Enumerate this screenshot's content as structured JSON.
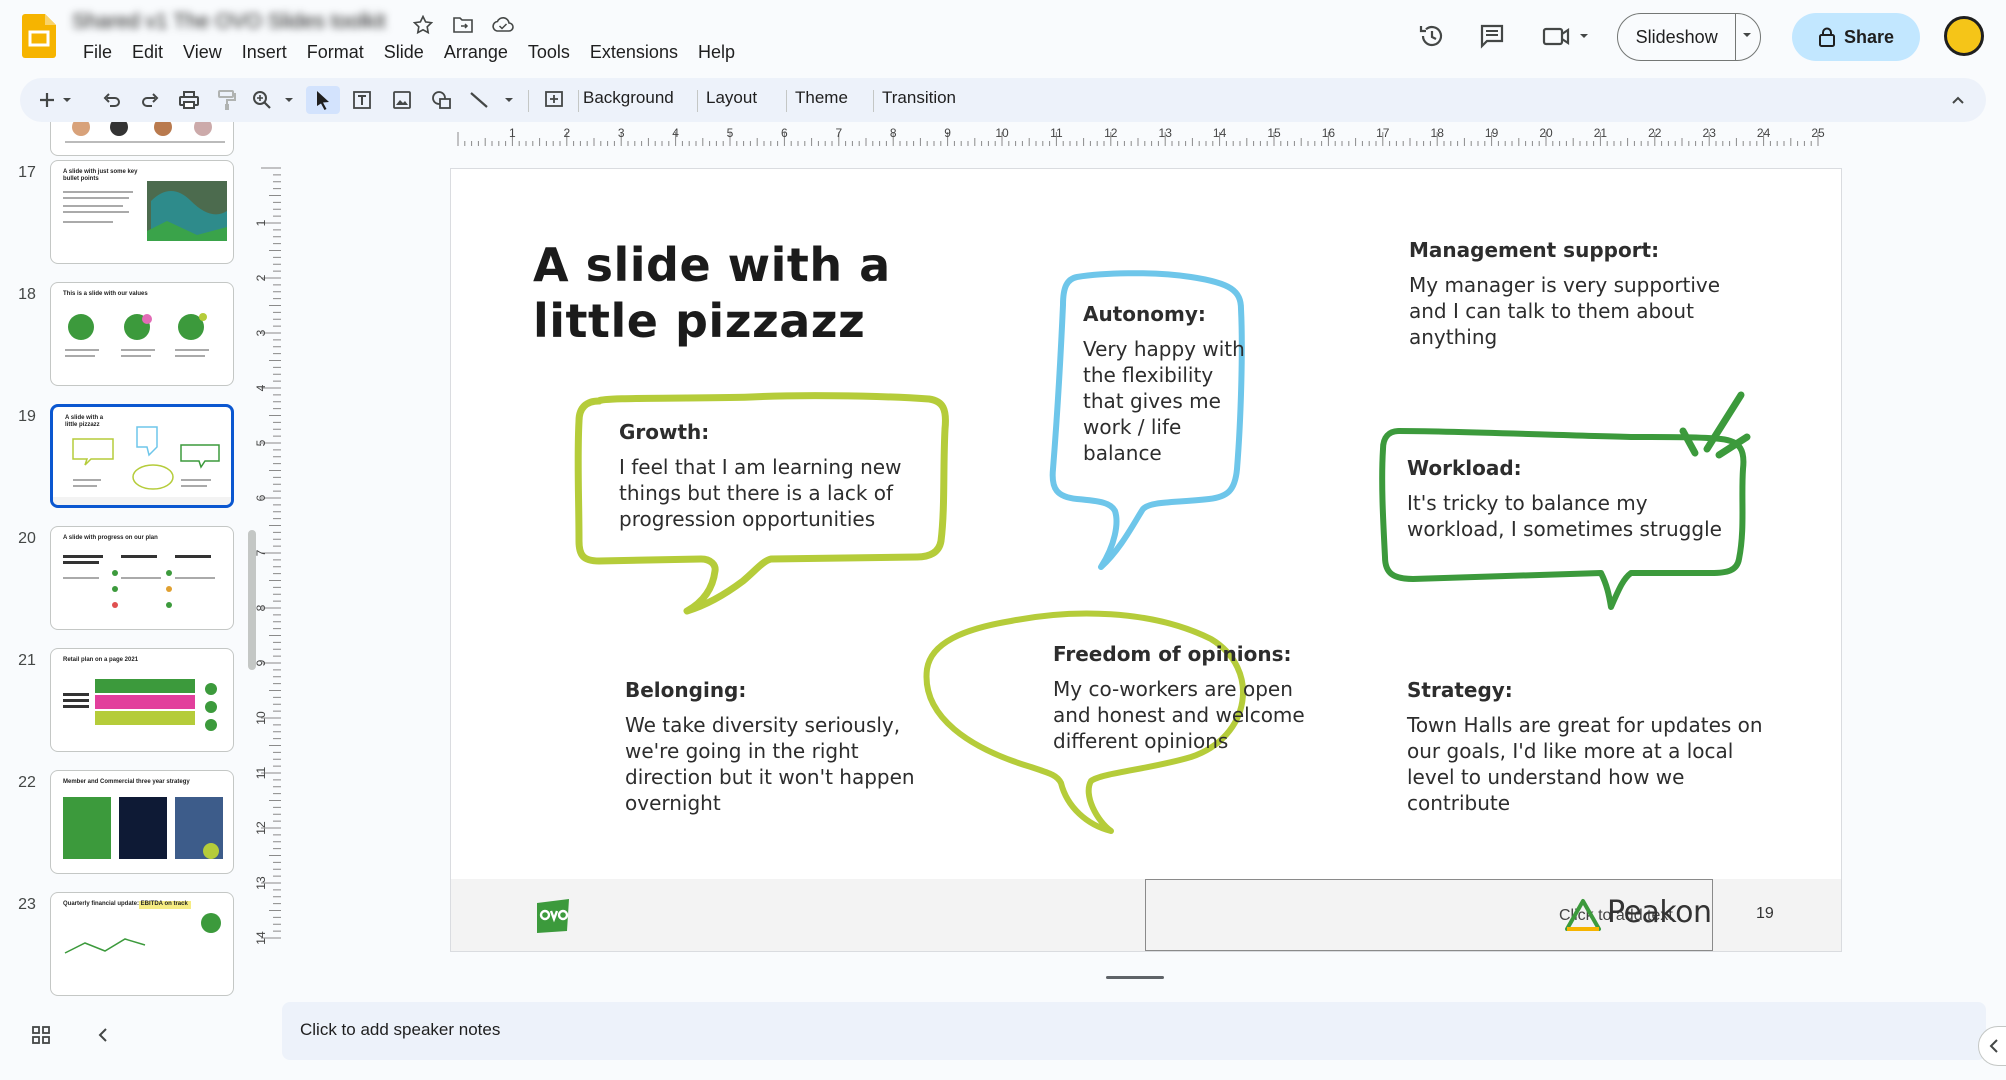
{
  "app": {
    "doc_title": "Shared v1 The OVO Slides toolkit",
    "menu": [
      "File",
      "Edit",
      "View",
      "Insert",
      "Format",
      "Slide",
      "Arrange",
      "Tools",
      "Extensions",
      "Help"
    ]
  },
  "header": {
    "slideshow_label": "Slideshow",
    "share_label": "Share"
  },
  "toolbar": {
    "background": "Background",
    "layout": "Layout",
    "theme": "Theme",
    "transition": "Transition"
  },
  "filmstrip": {
    "slides": [
      {
        "num": "17",
        "title": "A slide with just some key bullet points"
      },
      {
        "num": "18",
        "title": "This is a slide with our values"
      },
      {
        "num": "19",
        "title": "A slide with a little pizzazz"
      },
      {
        "num": "20",
        "title": "A slide with progress on our plan"
      },
      {
        "num": "21",
        "title": "Retail plan on a page 2021"
      },
      {
        "num": "22",
        "title": "Member and Commercial three year strategy"
      },
      {
        "num": "23",
        "title": "Quarterly financial update: EBITDA on track"
      }
    ]
  },
  "ruler": {
    "h": [
      "1",
      "2",
      "3",
      "4",
      "5",
      "6",
      "7",
      "8",
      "9",
      "10",
      "11",
      "12",
      "13",
      "14",
      "15",
      "16",
      "17",
      "18",
      "19",
      "20",
      "21",
      "22",
      "23",
      "24",
      "25"
    ],
    "v": [
      "1",
      "2",
      "3",
      "4",
      "5",
      "6",
      "7",
      "8",
      "9",
      "10",
      "11",
      "12",
      "13",
      "14"
    ]
  },
  "slide": {
    "title": "A slide with a little pizzazz",
    "bubbles": {
      "growth": {
        "heading": "Growth:",
        "body": "I feel that I am learning new things but there is a lack of progression opportunities"
      },
      "autonomy": {
        "heading": "Autonomy:",
        "body": "Very happy with the flexibility that gives me work / life balance"
      },
      "management": {
        "heading": "Management support:",
        "body": "My manager is very supportive and I can talk to them about anything"
      },
      "workload": {
        "heading": "Workload:",
        "body": "It's tricky to balance my workload, I sometimes struggle"
      },
      "belonging": {
        "heading": "Belonging:",
        "body": "We take diversity seriously, we're going in the right direction but it won't happen overnight"
      },
      "freedom": {
        "heading": "Freedom of opinions:",
        "body": "My co-workers are open and honest and welcome different opinions"
      },
      "strategy": {
        "heading": "Strategy:",
        "body": "Town Halls are great for updates on our goals, I'd like more at a local level to understand how we contribute"
      }
    },
    "footer": {
      "placeholder": "Click to add text",
      "brand": "Peakon",
      "page_number": "19"
    }
  },
  "notes": {
    "placeholder": "Click to add speaker notes"
  },
  "colors": {
    "lime": "#b5cc3a",
    "sky": "#6ec6ea",
    "green": "#3c9a3c",
    "accent_blue": "#0b57d0",
    "share_bg": "#c2e7ff"
  }
}
